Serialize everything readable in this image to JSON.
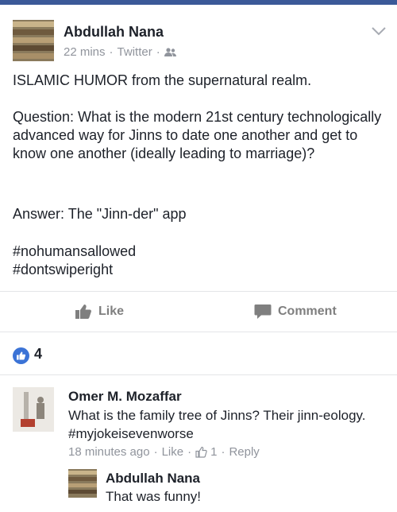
{
  "post": {
    "author": "Abdullah Nana",
    "time": "22 mins",
    "source": "Twitter",
    "meta_separator": "·",
    "line1": "ISLAMIC HUMOR from the supernatural realm.",
    "question": "Question: What is the modern 21st century technologically advanced way for Jinns to date one another and get to know one another (ideally leading to marriage)?",
    "answer": "Answer: The \"Jinn-der\" app",
    "hashtag1": "#nohumansallowed",
    "hashtag2": "#dontswiperight"
  },
  "actions": {
    "like_label": "Like",
    "comment_label": "Comment"
  },
  "reactions": {
    "count": "4"
  },
  "comments": [
    {
      "author": "Omer M. Mozaffar",
      "text": "What is the family tree of Jinns? Their jinn-eology. #myjokeisevenworse",
      "time": "18 minutes ago",
      "like_label": "Like",
      "like_count": "1",
      "reply_label": "Reply"
    },
    {
      "author": "Abdullah Nana",
      "text": "That was funny!"
    }
  ],
  "colors": {
    "brand": "#3b5998",
    "like_badge": "#3b73d6",
    "meta_gray": "#90949c",
    "action_gray": "#7f7f7f"
  },
  "icons": [
    "chevron-down-icon",
    "friends-icon",
    "thumbs-up-icon",
    "comment-icon",
    "like-reaction-icon",
    "small-like-icon"
  ]
}
